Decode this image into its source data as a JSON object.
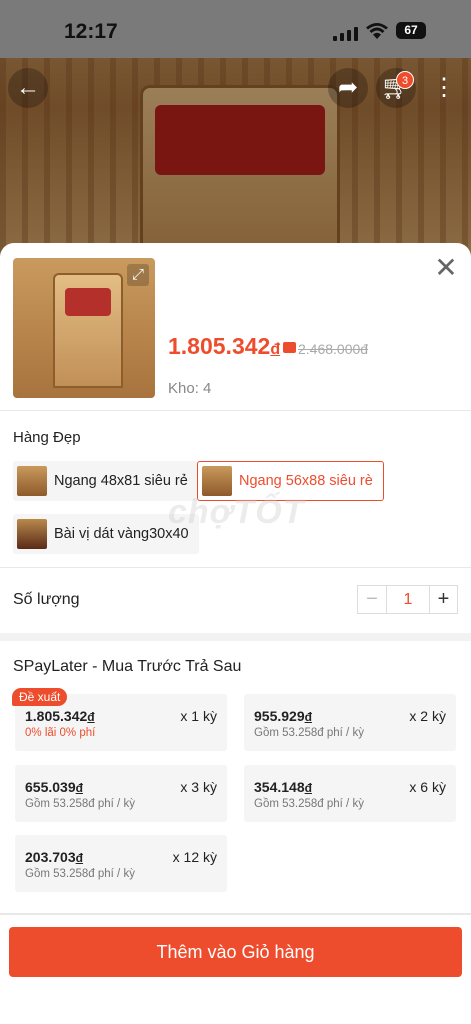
{
  "status_bar": {
    "time": "12:17",
    "battery": "67"
  },
  "nav": {
    "cart_count": "3",
    "back_icon": "arrow-left-icon",
    "share_icon": "share-icon",
    "cart_icon": "cart-icon",
    "more_icon": "more-vertical-icon"
  },
  "product": {
    "price": "1.805.342",
    "currency": "đ",
    "old_price": "2.468.000đ",
    "stock": "Kho: 4"
  },
  "variants": {
    "group_title": "Hàng Đẹp",
    "options": [
      {
        "label": "Ngang 48x81 siêu rẻ",
        "selected": false
      },
      {
        "label": "Ngang 56x88 siêu rè",
        "selected": true
      },
      {
        "label": "Bài vị dát vàng30x40",
        "selected": false
      }
    ]
  },
  "quantity": {
    "label": "Số lượng",
    "value": "1",
    "minus": "−",
    "plus": "+"
  },
  "spaylater": {
    "title": "SPayLater - Mua Trước Trả Sau",
    "badge": "Đề xuất",
    "plans": [
      {
        "amount": "1.805.342",
        "currency": "đ",
        "term": "x 1 kỳ",
        "fee": "0% lãi 0% phí",
        "highlight": true
      },
      {
        "amount": "955.929",
        "currency": "đ",
        "term": "x 2 kỳ",
        "fee": "Gồm 53.258đ phí / kỳ",
        "highlight": false
      },
      {
        "amount": "655.039",
        "currency": "đ",
        "term": "x 3 kỳ",
        "fee": "Gồm 53.258đ phí / kỳ",
        "highlight": false
      },
      {
        "amount": "354.148",
        "currency": "đ",
        "term": "x 6 kỳ",
        "fee": "Gồm 53.258đ phí / kỳ",
        "highlight": false
      },
      {
        "amount": "203.703",
        "currency": "đ",
        "term": "x 12 kỳ",
        "fee": "Gồm 53.258đ phí / kỳ",
        "highlight": false
      }
    ]
  },
  "watermark": "chợTỐT",
  "cta": {
    "add_to_cart": "Thêm vào Giỏ hàng"
  },
  "colors": {
    "accent": "#ee4d2d"
  }
}
